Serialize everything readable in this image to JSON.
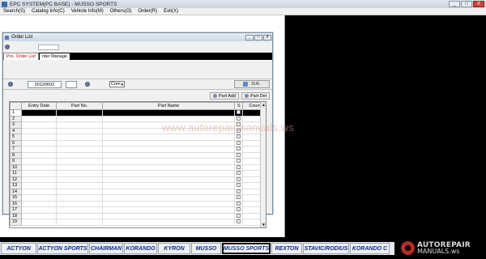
{
  "app": {
    "title": "EPC SYSTEM(PC BASE) - MUSSO SPORTS",
    "window_buttons": [
      "_",
      "□",
      "X"
    ]
  },
  "menu": [
    "Search(S)",
    "Catalog Info(C)",
    "Vehicle Info(M)",
    "Others(O)",
    "Order(R)",
    "Exit(X)"
  ],
  "order_window": {
    "title": "Order List",
    "window_buttons": [
      "_",
      "□",
      "X"
    ],
    "tabs": [
      "Pre. Order List",
      "rder Manage"
    ],
    "filters": {
      "date": "20120602",
      "combo_value": "Com",
      "ok_label": "O.K."
    },
    "part_add": "Part Add",
    "part_del": "Part Del",
    "columns": [
      "",
      "Entry Date",
      "Part No.",
      "Part Name",
      "S",
      "Count"
    ],
    "rows": [
      "1",
      "2",
      "3",
      "4",
      "5",
      "6",
      "7",
      "8",
      "9",
      "10",
      "11",
      "12",
      "13",
      "14",
      "15",
      "16",
      "17",
      "18",
      "19"
    ]
  },
  "watermark": "www.autorepairmanuals.ws",
  "vehicle_tabs": [
    "ACTYON",
    "ACTYON SPORTS",
    "CHAIRMAN",
    "KORANDO",
    "KYRON",
    "MUSSO",
    "MUSSO SPORTS",
    "REXTON",
    "STAVIC/RODIUS",
    "KORANDO C"
  ],
  "selected_vehicle": "MUSSO SPORTS",
  "logo": {
    "line1": "AUTOREPAIR",
    "line2": "MANUALS.ws"
  },
  "colors": {
    "tab_active_text": "#c00000",
    "vehicle_tab_text": "#0b2b8c",
    "logo_mark": "#b52a2a"
  }
}
